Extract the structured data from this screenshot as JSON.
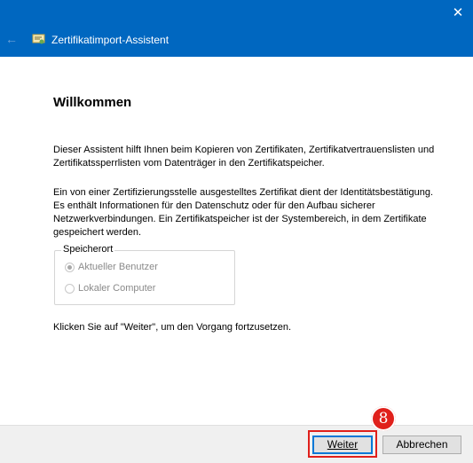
{
  "window": {
    "title": "Zertifikatimport-Assistent",
    "close_glyph": "✕",
    "back_glyph": "←",
    "accent_color": "#0067c0"
  },
  "main": {
    "heading": "Willkommen",
    "paragraph1": "Dieser Assistent hilft Ihnen beim Kopieren von Zertifikaten, Zertifikatvertrauenslisten und Zertifikatssperrlisten vom Datenträger in den Zertifikatspeicher.",
    "paragraph2": "Ein von einer Zertifizierungsstelle ausgestelltes Zertifikat dient der Identitätsbestätigung. Es enthält Informationen für den Datenschutz oder für den Aufbau sicherer Netzwerkverbindungen. Ein Zertifikatspeicher ist der Systembereich, in dem Zertifikate gespeichert werden.",
    "store_location": {
      "legend": "Speicherort",
      "options": [
        {
          "label": "Aktueller Benutzer",
          "selected": true,
          "disabled": true
        },
        {
          "label": "Lokaler Computer",
          "selected": false,
          "disabled": true
        }
      ]
    },
    "paragraph3": "Klicken Sie auf \"Weiter\", um den Vorgang fortzusetzen."
  },
  "footer": {
    "next_label": "Weiter",
    "cancel_label": "Abbrechen"
  },
  "annotation": {
    "step_number": "8",
    "highlight_color": "#e0201b"
  }
}
